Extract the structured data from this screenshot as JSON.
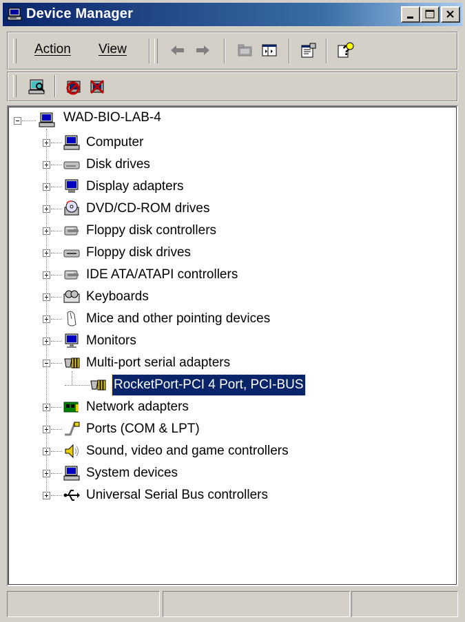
{
  "window": {
    "title": "Device Manager",
    "icon": "computer-monitor-icon",
    "caption_buttons": [
      "minimize-icon",
      "maximize-icon",
      "close-icon"
    ]
  },
  "menu": {
    "items": [
      {
        "label": "Action",
        "mnemonic": "A"
      },
      {
        "label": "View",
        "mnemonic": "V"
      }
    ]
  },
  "toolbar": {
    "buttons": [
      "back-arrow-icon",
      "forward-arrow-icon",
      "up-folder-icon",
      "show-hide-tree-icon",
      "properties-icon",
      "help-icon"
    ],
    "action_buttons": [
      "scan-hardware-icon",
      "disable-device-icon",
      "uninstall-device-icon"
    ]
  },
  "tree": {
    "root": "WAD-BIO-LAB-4",
    "categories": [
      {
        "label": "Computer",
        "icon": "computer-icon",
        "expanded": false
      },
      {
        "label": "Disk drives",
        "icon": "disk-drive-icon",
        "expanded": false
      },
      {
        "label": "Display adapters",
        "icon": "display-adapter-icon",
        "expanded": false
      },
      {
        "label": "DVD/CD-ROM drives",
        "icon": "cdrom-icon",
        "expanded": false
      },
      {
        "label": "Floppy disk controllers",
        "icon": "floppy-controller-icon",
        "expanded": false
      },
      {
        "label": "Floppy disk drives",
        "icon": "floppy-drive-icon",
        "expanded": false
      },
      {
        "label": "IDE ATA/ATAPI controllers",
        "icon": "ide-controller-icon",
        "expanded": false
      },
      {
        "label": "Keyboards",
        "icon": "keyboard-icon",
        "expanded": false
      },
      {
        "label": "Mice and other pointing devices",
        "icon": "mouse-icon",
        "expanded": false
      },
      {
        "label": "Monitors",
        "icon": "monitor-icon",
        "expanded": false
      },
      {
        "label": "Multi-port serial adapters",
        "icon": "serial-adapter-icon",
        "expanded": true
      },
      {
        "label": "RocketPort-PCI 4 Port, PCI-BUS",
        "icon": "serial-adapter-icon",
        "child": true,
        "selected": true
      },
      {
        "label": "Network adapters",
        "icon": "network-adapter-icon",
        "expanded": false
      },
      {
        "label": "Ports (COM & LPT)",
        "icon": "port-icon",
        "expanded": false
      },
      {
        "label": "Sound, video and game controllers",
        "icon": "sound-icon",
        "expanded": false
      },
      {
        "label": "System devices",
        "icon": "system-device-icon",
        "expanded": false
      },
      {
        "label": "Universal Serial Bus controllers",
        "icon": "usb-icon",
        "expanded": false
      }
    ]
  },
  "status_bar": {
    "panes": [
      "",
      "",
      ""
    ]
  },
  "colors": {
    "title_gradient_start": "#0a246a",
    "title_gradient_end": "#a6caf0",
    "face": "#d4d0c8",
    "selection": "#0a246a"
  }
}
